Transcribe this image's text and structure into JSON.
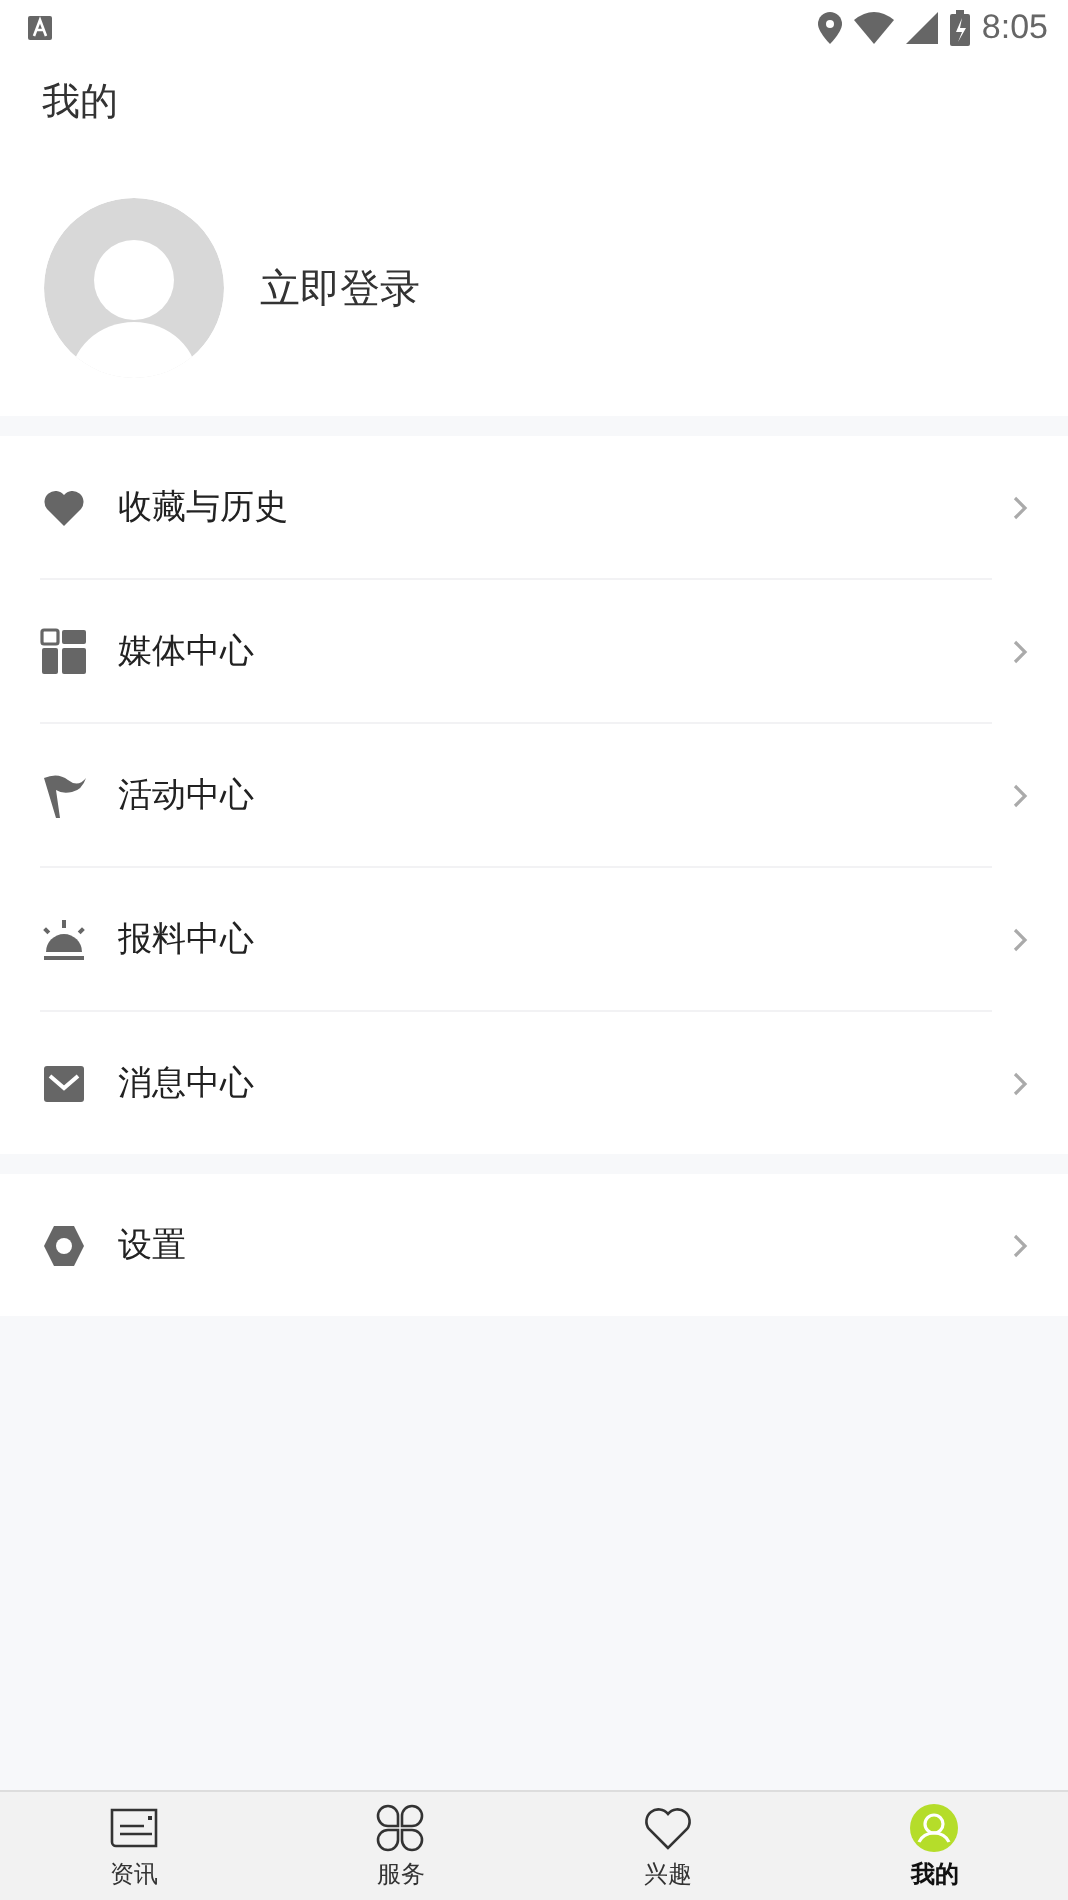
{
  "status_bar": {
    "time": "8:05"
  },
  "header": {
    "title": "我的"
  },
  "profile": {
    "login_label": "立即登录"
  },
  "sections": [
    {
      "items": [
        {
          "label": "收藏与历史"
        },
        {
          "label": "媒体中心"
        },
        {
          "label": "活动中心"
        },
        {
          "label": "报料中心"
        },
        {
          "label": "消息中心"
        }
      ]
    },
    {
      "items": [
        {
          "label": "设置"
        }
      ]
    }
  ],
  "tabs": [
    {
      "label": "资讯",
      "selected": false
    },
    {
      "label": "服务",
      "selected": false
    },
    {
      "label": "兴趣",
      "selected": false
    },
    {
      "label": "我的",
      "selected": true
    }
  ]
}
